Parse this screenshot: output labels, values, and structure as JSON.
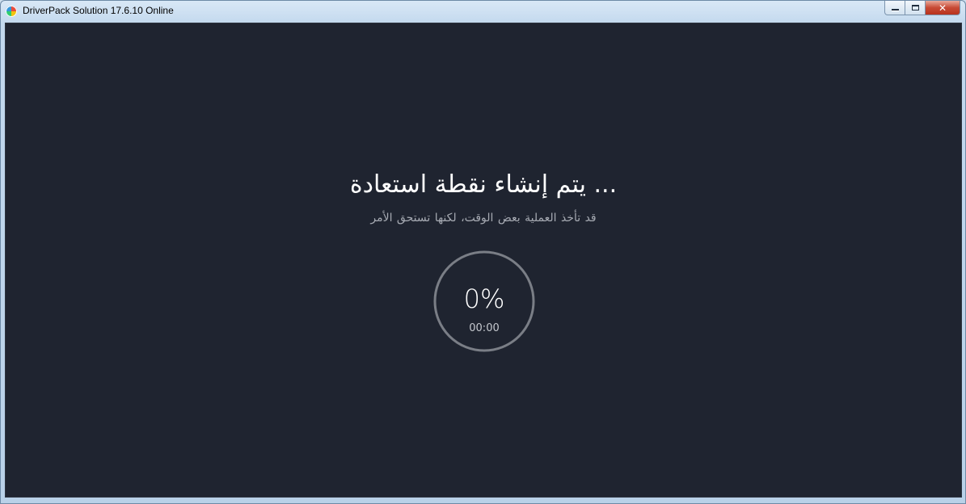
{
  "window": {
    "title": "DriverPack Solution 17.6.10 Online",
    "controls": {
      "minimize": "minimize",
      "maximize": "maximize",
      "close": "✕"
    }
  },
  "main": {
    "heading": "... يتم إنشاء نقطة استعادة",
    "subheading": "قد تأخذ العملية بعض الوقت،   لكنها تستحق الأمر",
    "progress": {
      "percent_label": "0%",
      "percent_value": 0,
      "timer": "00:00"
    }
  },
  "colors": {
    "client_bg": "#1f2430",
    "ring": "#7a7e86",
    "heading": "#ffffff",
    "subheading": "#a7abb3"
  },
  "icons": {
    "app": "driverpack-app-icon",
    "minimize": "minimize-icon",
    "maximize": "maximize-icon",
    "close": "close-icon"
  }
}
